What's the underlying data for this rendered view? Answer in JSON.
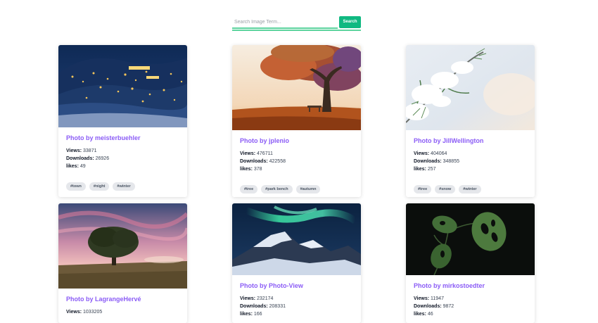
{
  "search": {
    "placeholder": "Search Image Term...",
    "button_label": "Search",
    "accent_color": "#10b981"
  },
  "cards": [
    {
      "author": "Photo by meisterbuehler",
      "views_label": "Views:",
      "views": "33871",
      "downloads_label": "Downloads:",
      "downloads": "26926",
      "likes_label": "likes:",
      "likes": "49",
      "tags": [
        "#town",
        "#night",
        "#winter"
      ],
      "image": "night-town-snow"
    },
    {
      "author": "Photo by jplenio",
      "views_label": "Views:",
      "views": "476711",
      "downloads_label": "Downloads:",
      "downloads": "422558",
      "likes_label": "likes:",
      "likes": "378",
      "tags": [
        "#tree",
        "#park bench",
        "#autumn"
      ],
      "image": "autumn-tree-bench"
    },
    {
      "author": "Photo by JillWellington",
      "views_label": "Views:",
      "views": "404064",
      "downloads_label": "Downloads:",
      "downloads": "348855",
      "likes_label": "likes:",
      "likes": "257",
      "tags": [
        "#tree",
        "#snow",
        "#winter"
      ],
      "image": "snowy-branch"
    },
    {
      "author": "Photo by LagrangeHervé",
      "views_label": "Views:",
      "views": "1033205",
      "image": "tree-sunset-field"
    },
    {
      "author": "Photo by Photo-View",
      "views_label": "Views:",
      "views": "232174",
      "downloads_label": "Downloads:",
      "downloads": "208331",
      "likes_label": "likes:",
      "likes": "166",
      "image": "aurora-mountains"
    },
    {
      "author": "Photo by mirkostoedter",
      "views_label": "Views:",
      "views": "11947",
      "downloads_label": "Downloads:",
      "downloads": "9872",
      "likes_label": "likes:",
      "likes": "46",
      "image": "monstera-leaves"
    }
  ]
}
